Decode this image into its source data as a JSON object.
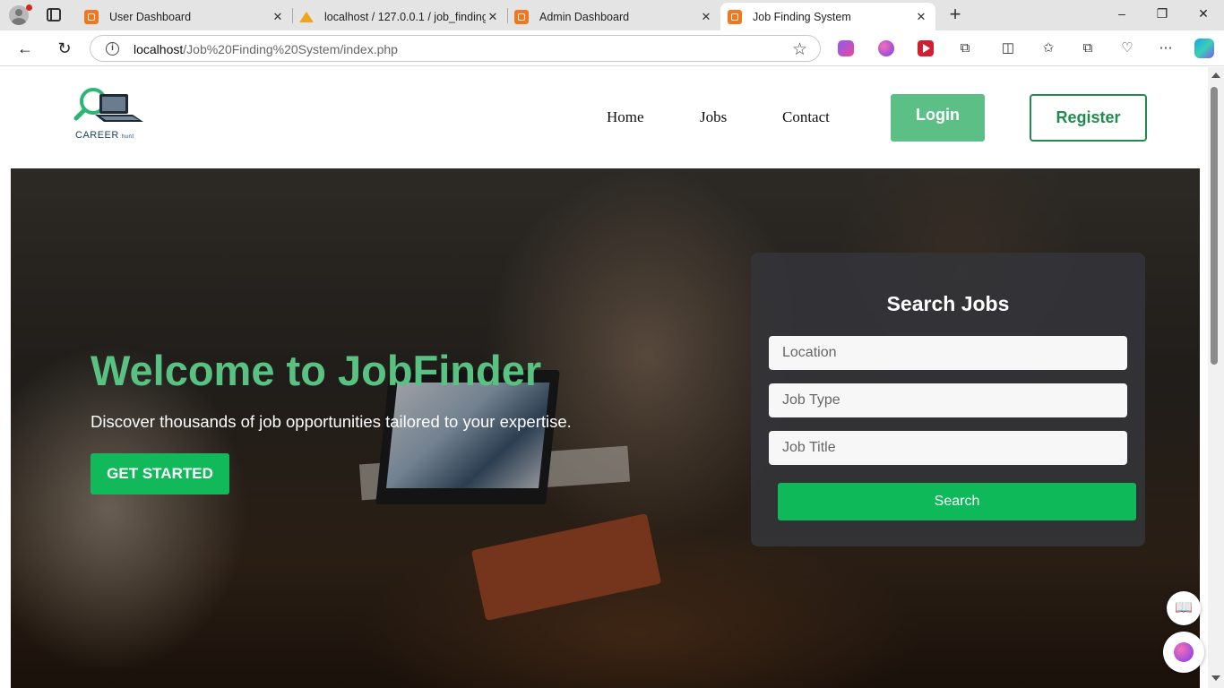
{
  "browser": {
    "tabs": [
      {
        "title": "User Dashboard",
        "favicon": "xampp-icon",
        "active": false
      },
      {
        "title": "localhost / 127.0.0.1 / job_finding_",
        "favicon": "phpmyadmin-icon",
        "active": false
      },
      {
        "title": "Admin Dashboard",
        "favicon": "xampp-icon",
        "active": false
      },
      {
        "title": "Job Finding System",
        "favicon": "xampp-icon",
        "active": true
      }
    ],
    "new_tab": "+",
    "url_host": "localhost",
    "url_path": "/Job%20Finding%20System/index.php",
    "window_controls": {
      "minimize": "–",
      "restore": "❐",
      "close": "✕"
    }
  },
  "site": {
    "logo": {
      "text": "CAREER",
      "small_text": "hunt"
    },
    "nav": [
      {
        "label": "Home"
      },
      {
        "label": "Jobs"
      },
      {
        "label": "Contact"
      }
    ],
    "login_label": "Login",
    "register_label": "Register"
  },
  "hero": {
    "title": "Welcome to JobFinder",
    "subtitle": "Discover thousands of job opportunities tailored to your expertise.",
    "cta_label": "GET STARTED"
  },
  "search": {
    "title": "Search Jobs",
    "location_placeholder": "Location",
    "job_type_placeholder": "Job Type",
    "job_title_placeholder": "Job Title",
    "button_label": "Search"
  },
  "colors": {
    "accent_green": "#59c283",
    "login_green": "#5cbf86",
    "register_green": "#1f8c4e",
    "search_button_green": "#0db959",
    "panel_dark": "#343438"
  }
}
